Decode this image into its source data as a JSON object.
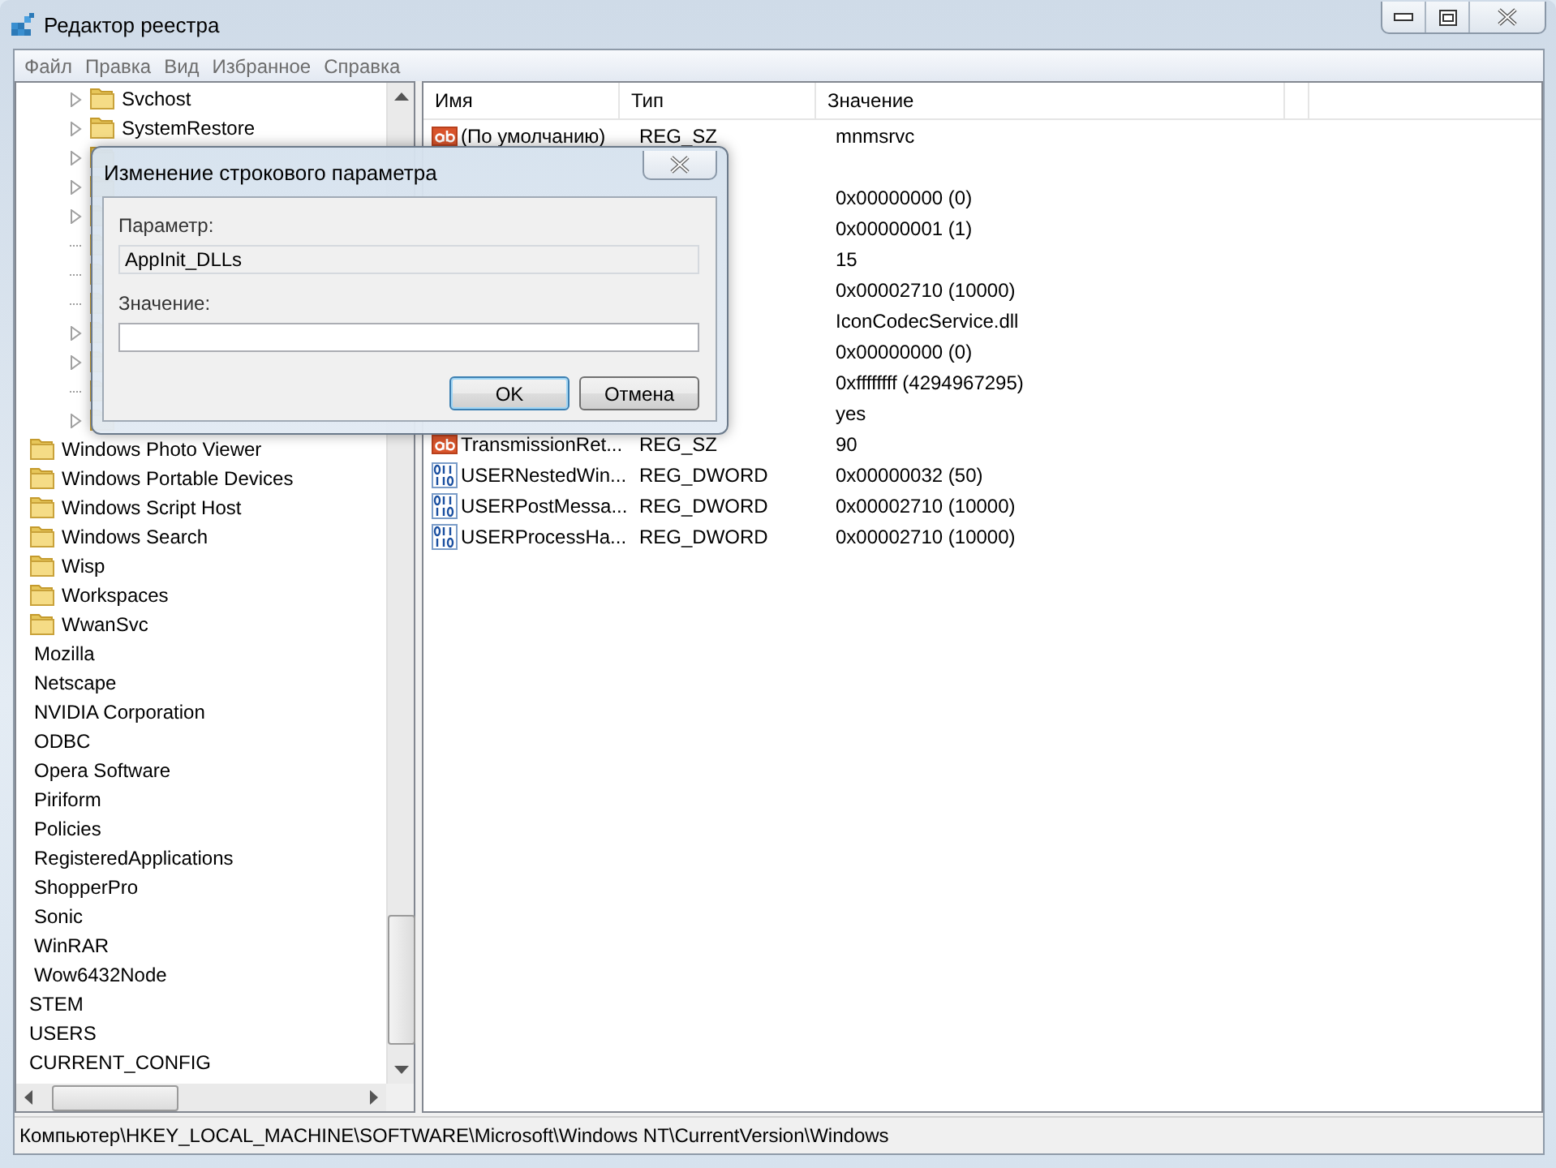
{
  "window": {
    "title": "Редактор реестра"
  },
  "menu": [
    "Файл",
    "Правка",
    "Вид",
    "Избранное",
    "Справка"
  ],
  "tree": [
    {
      "children": [
        {
          "children": [
            {
              "children": [
                {
                  "label": "Svchost",
                  "expandable": true
                },
                {
                  "label": "SystemRestore",
                  "expandable": true
                },
                {
                  "expandable": true
                },
                {
                  "expandable": true
                },
                {
                  "expandable": true
                },
                {
                  "expandable": false
                },
                {
                  "expandable": false
                },
                {
                  "expandable": false
                },
                {
                  "expandable": true
                },
                {
                  "expandable": true
                },
                {
                  "expandable": false
                },
                {
                  "expandable": true
                }
              ]
            },
            {
              "label": "Windows Photo Viewer"
            },
            {
              "label": "Windows Portable Devices"
            },
            {
              "label": "Windows Script Host"
            },
            {
              "label": "Windows Search"
            },
            {
              "label": "Wisp"
            },
            {
              "label": "Workspaces"
            },
            {
              "label": "WwanSvc"
            }
          ]
        },
        {
          "label": "Mozilla"
        },
        {
          "label": "Netscape"
        },
        {
          "label": "NVIDIA Corporation"
        },
        {
          "label": "ODBC"
        },
        {
          "label": "Opera Software"
        },
        {
          "label": "Piriform"
        },
        {
          "label": "Policies"
        },
        {
          "label": "RegisteredApplications"
        },
        {
          "label": "ShopperPro"
        },
        {
          "label": "Sonic"
        },
        {
          "label": "WinRAR"
        },
        {
          "label": "Wow6432Node"
        }
      ]
    },
    {
      "label": "STEM"
    },
    {
      "label": "USERS"
    },
    {
      "label": "CURRENT_CONFIG"
    }
  ],
  "table": {
    "columns": [
      "Имя",
      "Тип",
      "Значение"
    ],
    "rows": [
      {
        "kind": "string",
        "name": "(По умолчанию)",
        "type": "REG_SZ",
        "value": "mnmsrvc"
      },
      {},
      {
        "value": "0x00000000 (0)"
      },
      {
        "value": "0x00000001 (1)"
      },
      {
        "value": "15"
      },
      {
        "value": "0x00002710 (10000)"
      },
      {
        "value": "IconCodecService.dll"
      },
      {
        "value": "0x00000000 (0)"
      },
      {
        "value": "0xffffffff (4294967295)"
      },
      {
        "value": "yes"
      },
      {
        "kind": "string",
        "name": "TransmissionRet...",
        "type": "REG_SZ",
        "value": "90"
      },
      {
        "kind": "dword",
        "name": "USERNestedWin...",
        "type": "REG_DWORD",
        "value": "0x00000032 (50)"
      },
      {
        "kind": "dword",
        "name": "USERPostMessa...",
        "type": "REG_DWORD",
        "value": "0x00002710 (10000)"
      },
      {
        "kind": "dword",
        "name": "USERProcessHa...",
        "type": "REG_DWORD",
        "value": "0x00002710 (10000)"
      }
    ]
  },
  "dialog": {
    "title": "Изменение строкового параметра",
    "param_label": "Параметр:",
    "param_value": "AppInit_DLLs",
    "value_label": "Значение:",
    "buttons": [
      "OK",
      "Отмена"
    ]
  },
  "status_bar": "Компьютер\\HKEY_LOCAL_MACHINE\\SOFTWARE\\Microsoft\\Windows NT\\CurrentVersion\\Windows"
}
